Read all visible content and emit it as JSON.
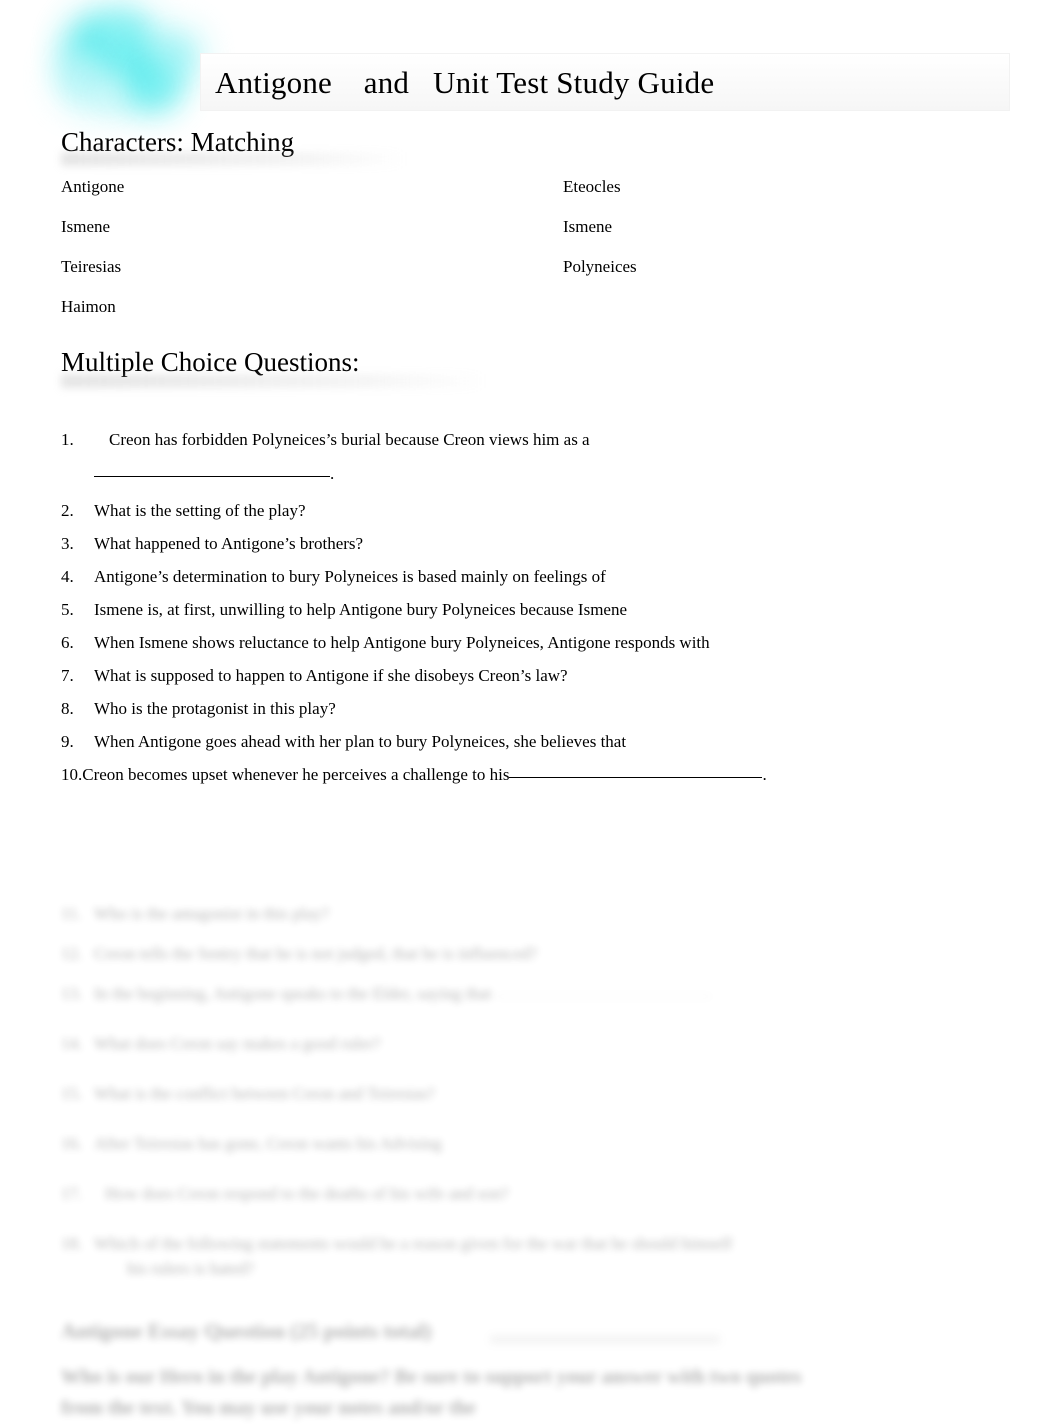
{
  "document": {
    "title": "Antigone    and   Unit Test Study Guide",
    "logo_name": "watercolor-splash-logo",
    "accent_color": "#3fe6e8",
    "background_color": "#ffffff",
    "text_color": "#000000"
  },
  "sections": {
    "characters": {
      "heading": "Characters: Matching",
      "left_column": [
        "Antigone",
        "Ismene",
        "Teiresias",
        "Haimon"
      ],
      "right_column": [
        "Eteocles",
        "Ismene",
        "Polyneices"
      ]
    },
    "multiple_choice": {
      "heading": "Multiple Choice Questions:",
      "questions": [
        {
          "number": "1.",
          "text": "Creon has forbidden Polyneices’s burial because Creon views him as a",
          "has_blank_line": true,
          "blank_suffix": "."
        },
        {
          "number": "2.",
          "text": "What is the setting of the play?"
        },
        {
          "number": "3.",
          "text": "What happened to Antigone’s brothers?"
        },
        {
          "number": "4.",
          "text": "Antigone’s determination to bury Polyneices is based mainly on feelings of"
        },
        {
          "number": "5.",
          "text": "Ismene is, at first, unwilling to help Antigone bury Polyneices because Ismene"
        },
        {
          "number": "6.",
          "text": "When Ismene shows reluctance to help Antigone bury Polyneices, Antigone responds with"
        },
        {
          "number": "7.",
          "text": "What is supposed to happen to Antigone if she disobeys Creon’s law?"
        },
        {
          "number": "8.",
          "text": "Who is the protagonist in this play?"
        },
        {
          "number": "9.",
          "text": "When Antigone goes ahead with her plan to bury Polyneices, she believes that"
        },
        {
          "number": "10.",
          "text": "Creon becomes upset whenever he perceives a challenge to his",
          "inline_blank": true,
          "blank_suffix": "."
        }
      ]
    },
    "obscured_lower": {
      "note": "blurred / illegible region",
      "questions": [
        {
          "number": "11.",
          "text": "Who is the antagonist in this play?"
        },
        {
          "number": "12.",
          "text": "Creon tells the Sentry that he is not judged, that he is influenced?"
        },
        {
          "number": "13.",
          "text": "In the beginning, Antigone speaks to the Elder, saying that"
        },
        {
          "number": "14.",
          "text": "What does Creon say makes a good ruler?"
        },
        {
          "number": "15.",
          "text": "What is the conflict between Creon and Teiresias?"
        },
        {
          "number": "16.",
          "text": "After Teiresias has gone, Creon wants his Advising"
        },
        {
          "number": "17.",
          "text": "How does Creon respond to the deaths of his wife and son?"
        },
        {
          "number": "18.",
          "text": "Which of the following statements would be a reason given for the war that he should himself",
          "continuation": "his rulers is hated?"
        }
      ],
      "essay": {
        "heading": "Antigone Essay Question (25 points total)",
        "body": "Who is our Hero in the play Antigone? Be sure to support your answer with two quotes from the text. You may use your notes and/or the"
      }
    }
  }
}
